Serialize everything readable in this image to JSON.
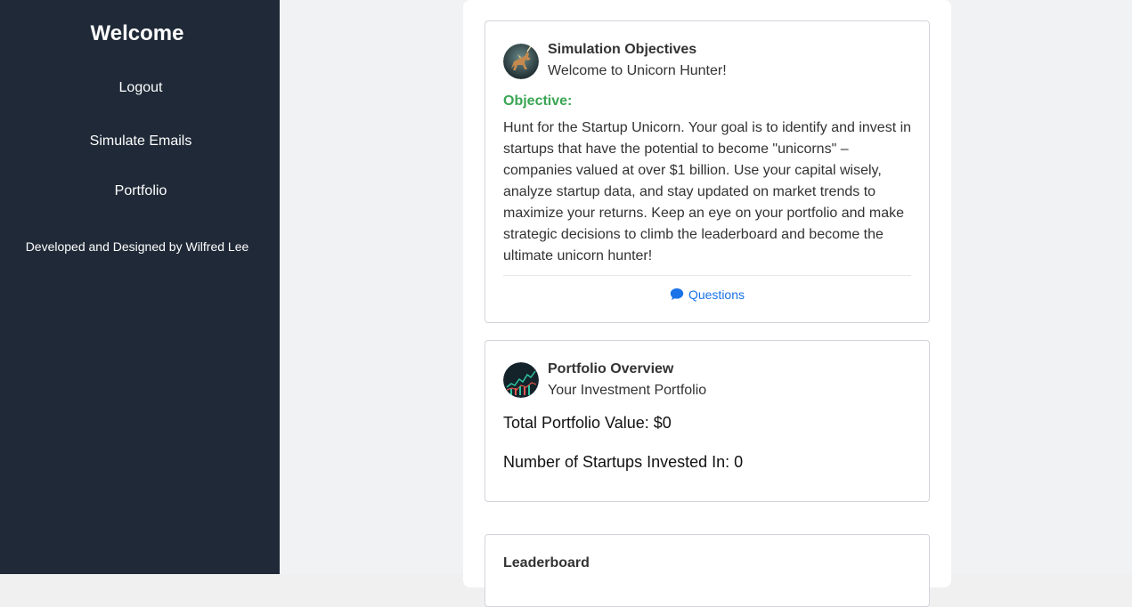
{
  "sidebar": {
    "title": "Welcome",
    "links": [
      "Logout",
      "Simulate Emails",
      "Portfolio"
    ],
    "credit": "Developed and Designed by Wilfred Lee"
  },
  "objectives": {
    "title": "Simulation Objectives",
    "subtitle": "Welcome to Unicorn Hunter!",
    "objective_label": "Objective:",
    "objective_text": "Hunt for the Startup Unicorn. Your goal is to identify and invest in startups that have the potential to become \"unicorns\" – companies valued at over $1 billion. Use your capital wisely, analyze startup data, and stay updated on market trends to maximize your returns. Keep an eye on your portfolio and make strategic decisions to climb the leaderboard and become the ultimate unicorn hunter!",
    "questions_label": "Questions",
    "questions_icon": "chat-bubble-icon",
    "avatar_icon": "unicorn-avatar-icon"
  },
  "portfolio": {
    "title": "Portfolio Overview",
    "subtitle": "Your Investment Portfolio",
    "total_value": "Total Portfolio Value: $0",
    "startups_count": "Number of Startups Invested In: 0",
    "avatar_icon": "stock-chart-avatar-icon"
  },
  "leaderboard": {
    "title": "Leaderboard"
  },
  "colors": {
    "sidebar_bg": "#1f2937",
    "objective_green": "#3aa655",
    "link_blue": "#1a73e8"
  }
}
